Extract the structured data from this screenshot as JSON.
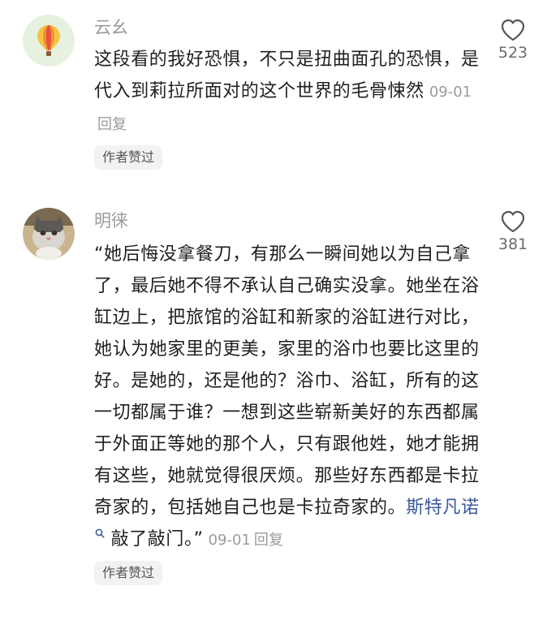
{
  "comments": [
    {
      "username": "云幺",
      "avatar_icon": "hot-air-balloon-icon",
      "text": "这段看的我好恐惧，不只是扭曲面孔的恐惧，是代入到莉拉所面对的这个世界的毛骨悚然",
      "date": "09-01",
      "reply_label": "回复",
      "badge": "作者赞过",
      "likes": "523"
    },
    {
      "username": "明徕",
      "avatar_icon": "cat-avatar-icon",
      "text_before_mention": "“她后悔没拿餐刀，有那么一瞬间她以为自己拿了，最后她不得不承认自己确实没拿。她坐在浴缸边上，把旅馆的浴缸和新家的浴缸进行对比，她认为她家里的更美，家里的浴巾也要比这里的好。是她的，还是他的？浴巾、浴缸，所有的这一切都属于谁？一想到这些崭新美好的东西都属于外面正等她的那个人，只有跟他姓，她才能拥有这些，她就觉得很厌烦。那些好东西都是卡拉奇家的，包括她自己也是卡拉奇家的。",
      "mention": "斯特凡诺",
      "text_after_mention": " 敲了敲门。”",
      "date": "09-01",
      "reply_label": "回复",
      "badge": "作者赞过",
      "likes": "381"
    }
  ],
  "colors": {
    "mention": "#3b5998",
    "meta": "#9b9b9b",
    "badge_bg": "#f2f2f2"
  }
}
